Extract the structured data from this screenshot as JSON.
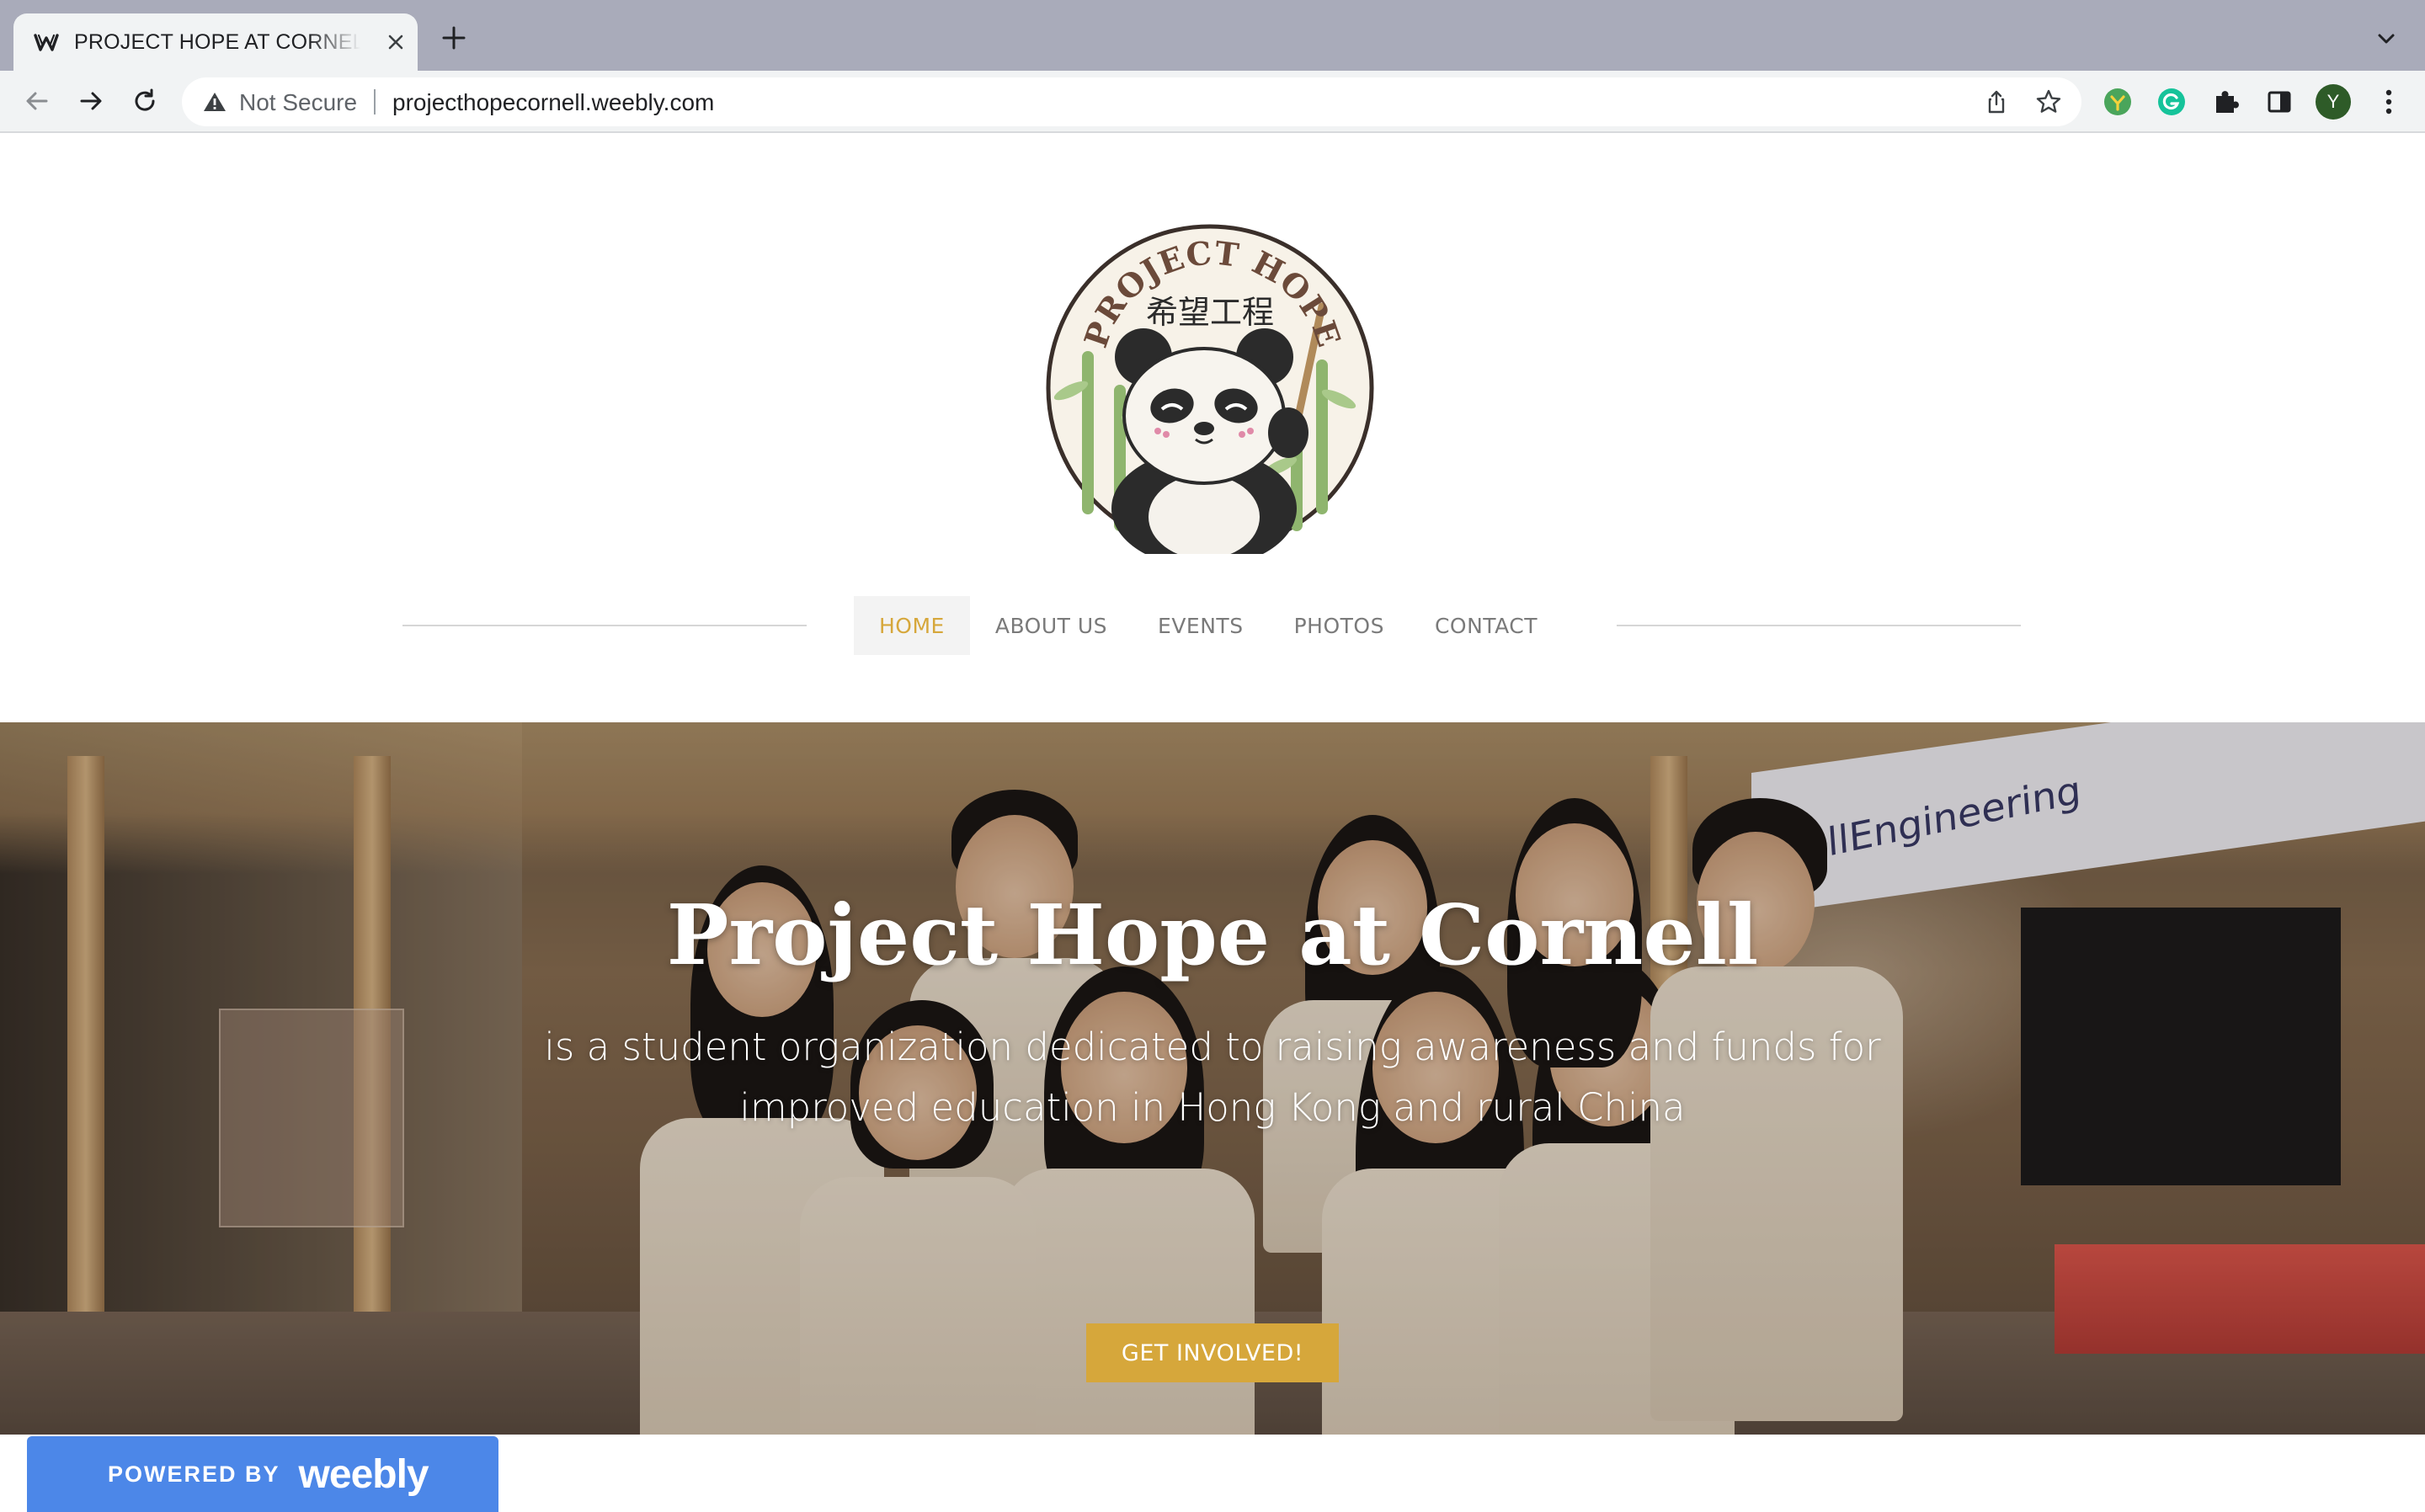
{
  "browser": {
    "tab_title": "PROJECT HOPE AT CORNELL - Home",
    "omnibox": {
      "security_label": "Not Secure",
      "url": "projecthopecornell.weebly.com"
    },
    "avatar_initial": "Y",
    "icons": [
      "weebly-favicon",
      "close-icon",
      "plus-icon",
      "chevron-down-icon",
      "back-arrow-icon",
      "forward-arrow-icon",
      "reload-icon",
      "warning-icon",
      "share-icon",
      "star-icon",
      "extension-icon",
      "grammarly-icon",
      "puzzle-icon",
      "side-panel-icon",
      "more-vert-icon"
    ]
  },
  "site": {
    "logo_text": "PROJECT HOPE",
    "logo_chinese": "希望工程",
    "nav": [
      {
        "label": "HOME",
        "active": true
      },
      {
        "label": "ABOUT US",
        "active": false
      },
      {
        "label": "EVENTS",
        "active": false
      },
      {
        "label": "PHOTOS",
        "active": false
      },
      {
        "label": "CONTACT",
        "active": false
      }
    ],
    "hero": {
      "title": "Project Hope at Cornell",
      "subtitle": "is a student organization dedicated to raising awareness and funds for improved education in Hong Kong and rural China",
      "cta_label": "GET INVOLVED!",
      "banner_text": "llEngineering"
    },
    "powered_by": {
      "label": "POWERED BY",
      "brand": "weebly"
    },
    "colors": {
      "accent": "#d6a73b",
      "nav_text": "#7a7a7a",
      "powered_bg": "#4c87e8"
    }
  }
}
